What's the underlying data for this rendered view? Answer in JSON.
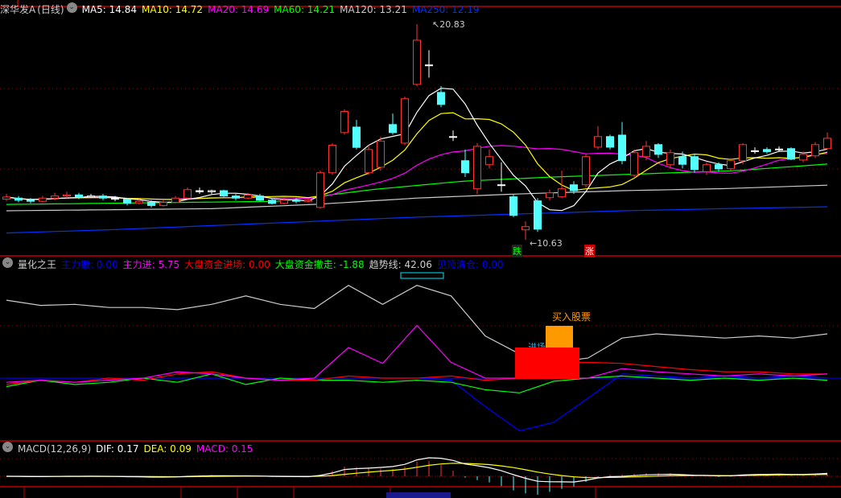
{
  "main": {
    "stock_name": "深华发A",
    "period": "(日线)",
    "ma": [
      {
        "label": "MA5: 14.84",
        "color": "#ffffff"
      },
      {
        "label": "MA10: 14.72",
        "color": "#ffff00"
      },
      {
        "label": "MA20: 14.69",
        "color": "#ff00ff"
      },
      {
        "label": "MA60: 14.21",
        "color": "#00ff00"
      },
      {
        "label": "MA120: 13.21",
        "color": "#cccccc"
      },
      {
        "label": "MA250: 12.19",
        "color": "#0033ff"
      }
    ],
    "high_label": "20.83",
    "low_label": "10.63",
    "high_price": 20.83,
    "low_price": 10.63,
    "signal_down": "跌",
    "signal_up": "涨",
    "ma60_curve": [
      12.3,
      12.35,
      12.4,
      12.45,
      13.0,
      13.4,
      13.6,
      13.75,
      13.9,
      14.21
    ],
    "ma120_curve": [
      12.0,
      12.05,
      12.1,
      12.3,
      12.6,
      12.8,
      12.95,
      13.05,
      13.21
    ],
    "ma250_curve": [
      10.95,
      11.1,
      11.3,
      11.5,
      11.7,
      11.85,
      12.0,
      12.1,
      12.19
    ],
    "candles": [
      [
        12.55,
        12.65,
        12.8,
        12.45
      ],
      [
        12.6,
        12.5,
        12.7,
        12.4
      ],
      [
        12.5,
        12.45,
        12.6,
        12.35
      ],
      [
        12.45,
        12.6,
        12.7,
        12.4
      ],
      [
        12.6,
        12.7,
        12.85,
        12.5
      ],
      [
        12.7,
        12.75,
        12.9,
        12.6
      ],
      [
        12.75,
        12.65,
        12.85,
        12.55
      ],
      [
        12.65,
        12.7,
        12.8,
        12.6
      ],
      [
        12.7,
        12.6,
        12.8,
        12.5
      ],
      [
        12.6,
        12.55,
        12.7,
        12.45
      ],
      [
        12.55,
        12.35,
        12.6,
        12.25
      ],
      [
        12.35,
        12.45,
        12.55,
        12.3
      ],
      [
        12.4,
        12.25,
        12.5,
        12.15
      ],
      [
        12.25,
        12.4,
        12.5,
        12.2
      ],
      [
        12.4,
        12.6,
        12.7,
        12.35
      ],
      [
        12.6,
        13.0,
        13.1,
        12.55
      ],
      [
        12.95,
        12.9,
        13.1,
        12.8
      ],
      [
        12.9,
        12.95,
        13.0,
        12.8
      ],
      [
        12.95,
        12.7,
        13.0,
        12.65
      ],
      [
        12.7,
        12.6,
        12.8,
        12.5
      ],
      [
        12.6,
        12.75,
        12.85,
        12.55
      ],
      [
        12.7,
        12.5,
        12.8,
        12.45
      ],
      [
        12.5,
        12.35,
        12.6,
        12.3
      ],
      [
        12.35,
        12.5,
        12.6,
        12.3
      ],
      [
        12.5,
        12.45,
        12.6,
        12.35
      ],
      [
        12.45,
        12.5,
        12.6,
        12.4
      ],
      [
        12.16,
        13.8,
        13.9,
        12.1
      ],
      [
        13.8,
        15.1,
        15.2,
        13.7
      ],
      [
        15.7,
        16.7,
        16.8,
        15.6
      ],
      [
        15.96,
        15.0,
        16.3,
        14.9
      ],
      [
        13.8,
        14.9,
        15.1,
        13.7
      ],
      [
        14.06,
        15.3,
        15.5,
        13.9
      ],
      [
        16.08,
        15.7,
        16.6,
        15.6
      ],
      [
        15.2,
        17.3,
        17.4,
        15.1
      ],
      [
        17.98,
        20.07,
        20.83,
        17.9
      ],
      [
        18.9,
        18.88,
        19.6,
        18.3
      ],
      [
        17.6,
        17.03,
        17.9,
        16.9
      ],
      [
        15.51,
        15.5,
        15.8,
        15.3
      ],
      [
        14.37,
        13.8,
        14.9,
        13.6
      ],
      [
        13.04,
        15.05,
        15.2,
        12.8
      ],
      [
        14.18,
        14.56,
        14.9,
        14.0
      ],
      [
        13.2,
        13.23,
        14.3,
        12.9
      ],
      [
        12.66,
        11.78,
        12.8,
        11.7
      ],
      [
        11.1,
        11.25,
        11.5,
        10.63
      ],
      [
        12.47,
        11.13,
        12.6,
        11.0
      ],
      [
        12.62,
        12.85,
        13.0,
        12.5
      ],
      [
        12.66,
        13.04,
        13.9,
        12.6
      ],
      [
        13.23,
        12.95,
        13.4,
        12.8
      ],
      [
        13.23,
        14.56,
        14.7,
        13.1
      ],
      [
        15.01,
        15.51,
        16.0,
        14.9
      ],
      [
        15.51,
        15.01,
        15.6,
        14.9
      ],
      [
        15.58,
        14.37,
        16.2,
        14.2
      ],
      [
        13.68,
        14.75,
        14.9,
        13.6
      ],
      [
        14.56,
        15.05,
        15.3,
        14.4
      ],
      [
        15.13,
        14.67,
        15.2,
        14.5
      ],
      [
        14.18,
        14.75,
        14.9,
        14.0
      ],
      [
        14.56,
        14.2,
        14.8,
        14.0
      ],
      [
        14.56,
        13.95,
        14.7,
        13.8
      ],
      [
        13.85,
        14.18,
        14.3,
        13.7
      ],
      [
        14.18,
        13.98,
        14.3,
        13.85
      ],
      [
        13.99,
        14.37,
        14.5,
        13.9
      ],
      [
        14.37,
        15.13,
        15.2,
        14.2
      ],
      [
        14.82,
        14.84,
        15.0,
        14.7
      ],
      [
        14.9,
        14.8,
        15.0,
        14.7
      ],
      [
        14.9,
        14.92,
        15.05,
        14.8
      ],
      [
        14.94,
        14.44,
        15.0,
        14.4
      ],
      [
        14.4,
        14.67,
        14.8,
        14.3
      ],
      [
        14.6,
        15.13,
        15.25,
        14.5
      ],
      [
        14.94,
        15.43,
        15.7,
        14.9
      ]
    ]
  },
  "indicator": {
    "name": "量化之王",
    "values": [
      {
        "label": "主力撤: 0.00",
        "color": "#0000ff"
      },
      {
        "label": "主力进: 5.75",
        "color": "#ff00ff"
      },
      {
        "label": "大盘资金进场: 0.00",
        "color": "#ff0000"
      },
      {
        "label": "大盘资金撤走: -1.88",
        "color": "#00ff00"
      },
      {
        "label": "趋势线: 42.06",
        "color": "#cccccc"
      },
      {
        "label": "见顶清仓: 0.00",
        "color": "#0000ff"
      }
    ],
    "buy_label": "买入股票",
    "entry_label": "进场",
    "series": {
      "trend": [
        74,
        69,
        70,
        67,
        67,
        65,
        70,
        78,
        70,
        66,
        88,
        70,
        88,
        78,
        40,
        23,
        15,
        19,
        38,
        42,
        40,
        38,
        40,
        38,
        42
      ],
      "main_in": [
        -4,
        -2,
        -4,
        -2,
        0,
        6,
        4,
        0,
        -2,
        0,
        29,
        14,
        50,
        15,
        0,
        0,
        0,
        0,
        9,
        6,
        4,
        2,
        4,
        2,
        4
      ],
      "market_in": [
        -6,
        -2,
        -4,
        0,
        -2,
        4,
        6,
        0,
        -2,
        -2,
        2,
        0,
        0,
        2,
        -2,
        0,
        15,
        15,
        14,
        11,
        8,
        6,
        6,
        4,
        4
      ],
      "market_out": [
        -8,
        -2,
        -6,
        -4,
        0,
        -4,
        4,
        -6,
        0,
        -2,
        -2,
        -4,
        -2,
        -4,
        -11,
        -14,
        -3,
        0,
        2,
        0,
        -2,
        0,
        -2,
        0,
        -2
      ],
      "main_out": [
        0,
        0,
        0,
        0,
        0,
        0,
        0,
        0,
        0,
        0,
        0,
        0,
        0,
        -2,
        -27,
        -50,
        -42,
        -19,
        4,
        2,
        0,
        2,
        0,
        2,
        0
      ]
    }
  },
  "macd": {
    "title": "MACD(12,26,9)",
    "dif": "DIF: 0.17",
    "dea": "DEA: 0.09",
    "macd": "MACD: 0.15"
  }
}
